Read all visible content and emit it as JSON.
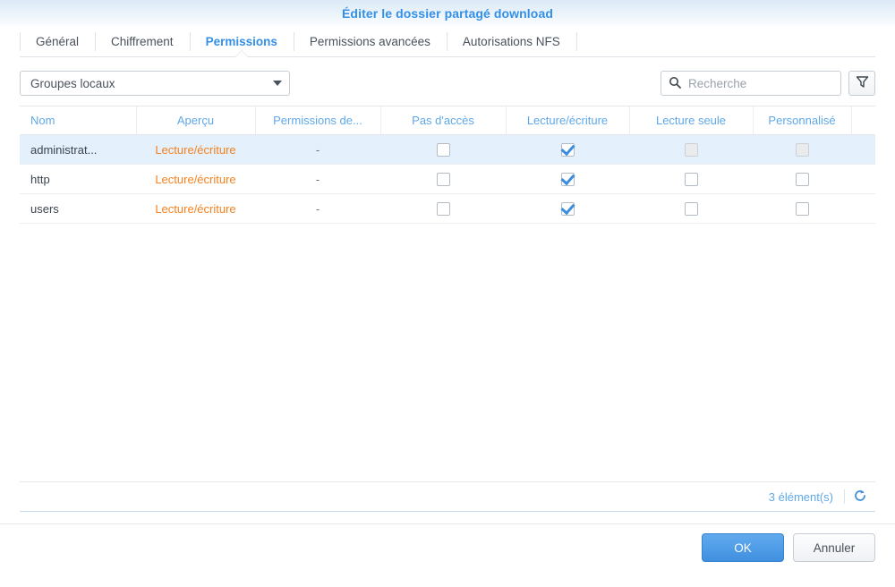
{
  "dialog": {
    "title": "Éditer le dossier partagé download"
  },
  "tabs": [
    {
      "label": "Général",
      "active": false
    },
    {
      "label": "Chiffrement",
      "active": false
    },
    {
      "label": "Permissions",
      "active": true
    },
    {
      "label": "Permissions avancées",
      "active": false
    },
    {
      "label": "Autorisations NFS",
      "active": false
    }
  ],
  "toolbar": {
    "group_select_value": "Groupes locaux",
    "group_select_icon": "chevron-down-icon",
    "search_placeholder": "Recherche",
    "search_value": "",
    "search_icon": "search-icon",
    "filter_icon": "funnel-icon"
  },
  "grid": {
    "columns": [
      "Nom",
      "Aperçu",
      "Permissions de...",
      "Pas d'accès",
      "Lecture/écriture",
      "Lecture seule",
      "Personnalisé"
    ],
    "rows": [
      {
        "name": "administrat...",
        "preview": "Lecture/écriture",
        "permissions": "-",
        "no_access": false,
        "read_write": true,
        "read_only": false,
        "custom": false,
        "read_only_disabled": true,
        "custom_disabled": true,
        "selected": true
      },
      {
        "name": "http",
        "preview": "Lecture/écriture",
        "permissions": "-",
        "no_access": false,
        "read_write": true,
        "read_only": false,
        "custom": false,
        "read_only_disabled": false,
        "custom_disabled": false,
        "selected": false
      },
      {
        "name": "users",
        "preview": "Lecture/écriture",
        "permissions": "-",
        "no_access": false,
        "read_write": true,
        "read_only": false,
        "custom": false,
        "read_only_disabled": false,
        "custom_disabled": false,
        "selected": false
      }
    ]
  },
  "status": {
    "count_label": "3 élément(s)",
    "refresh_icon": "refresh-icon"
  },
  "footer": {
    "ok_label": "OK",
    "cancel_label": "Annuler"
  },
  "colors": {
    "accent_blue": "#3490e6",
    "header_blue": "#5fa8e8",
    "preview_orange": "#f58220",
    "row_selected": "#e4f0fb"
  }
}
